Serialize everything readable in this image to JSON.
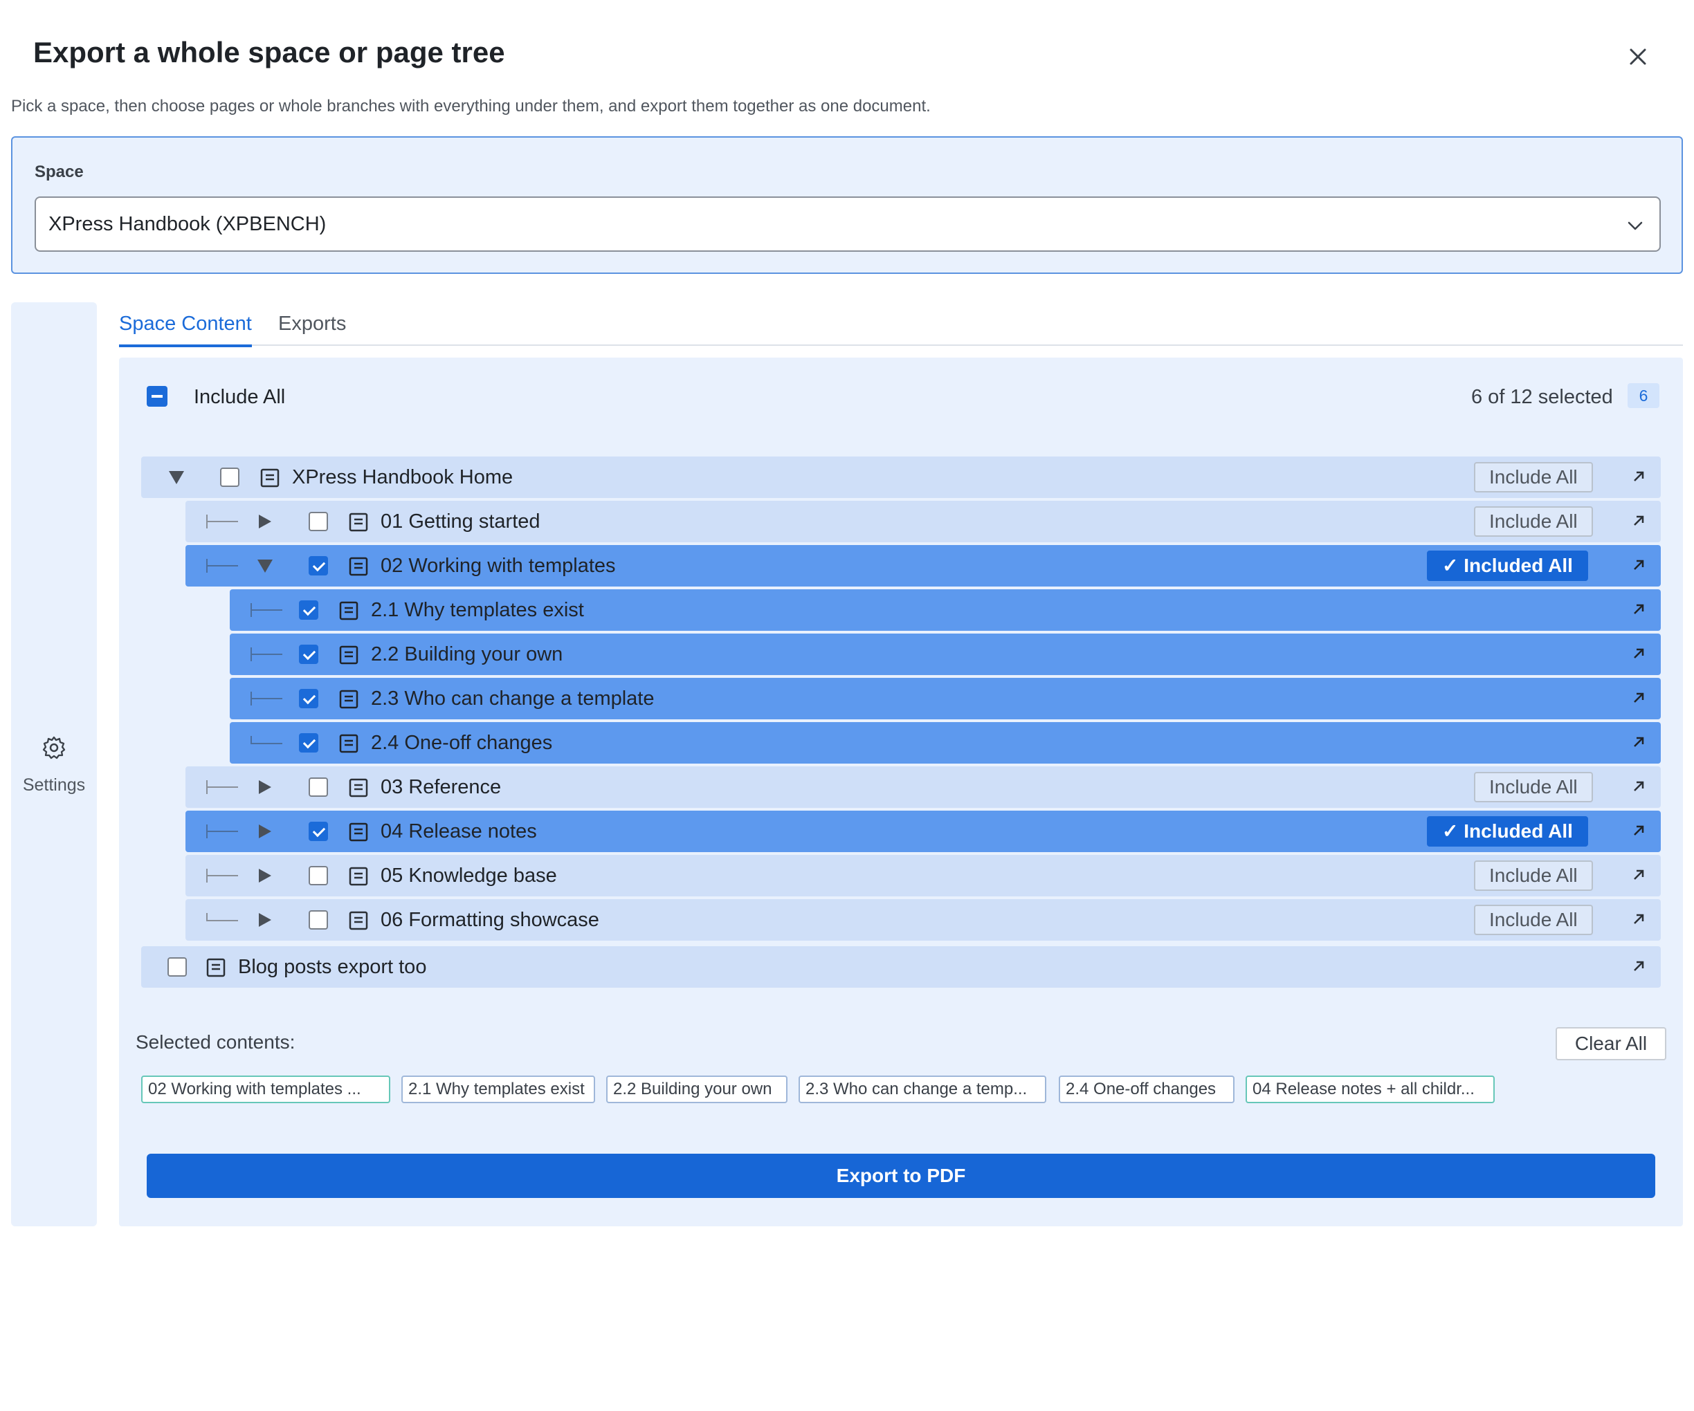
{
  "dialog": {
    "title": "Export a whole space or page tree",
    "subtitle": "Pick a space, then choose pages or whole branches with everything under them, and export them together as one document."
  },
  "space": {
    "label": "Space",
    "selected": "XPress Handbook (XPBENCH)"
  },
  "sidebar": {
    "settings_label": "Settings"
  },
  "tabs": [
    {
      "label": "Space Content",
      "active": true
    },
    {
      "label": "Exports",
      "active": false
    }
  ],
  "content": {
    "include_all_label": "Include All",
    "selected_count_text": "6 of 12 selected",
    "selected_badge": "6",
    "include_all_button": "Include All",
    "included_all_button": "✓ Included All",
    "tree": [
      {
        "label": "XPress Handbook Home",
        "checked": false,
        "expanded": true
      },
      {
        "label": "01 Getting started",
        "checked": false
      },
      {
        "label": "02 Working with templates",
        "checked": true,
        "expanded": true
      },
      {
        "label": "2.1 Why templates exist",
        "checked": true
      },
      {
        "label": "2.2 Building your own",
        "checked": true
      },
      {
        "label": "2.3 Who can change a template",
        "checked": true
      },
      {
        "label": "2.4 One-off changes",
        "checked": true
      },
      {
        "label": "03 Reference",
        "checked": false
      },
      {
        "label": "04 Release notes",
        "checked": true
      },
      {
        "label": "05 Knowledge base",
        "checked": false
      },
      {
        "label": "06 Formatting showcase",
        "checked": false
      },
      {
        "label": "Blog posts export too",
        "checked": false
      }
    ],
    "selected_title": "Selected contents:",
    "clear_all": "Clear All",
    "chips": [
      "02 Working with templates ...",
      "2.1 Why templates exist",
      "2.2 Building your own",
      "2.3 Who can change a temp...",
      "2.4 One-off changes",
      "04 Release notes + all childr..."
    ],
    "export_button": "Export to PDF"
  },
  "colors": {
    "accent": "#1b6bd9",
    "panel_bg": "#e9f1fd",
    "row_bg": "#cfdff8",
    "row_selected_bg": "#5d99ee",
    "chip_border": "#66c7b8"
  },
  "icons": [
    "close-icon",
    "chevron-down-icon",
    "gear-icon",
    "page-icon",
    "open-external-icon",
    "expand-triangle-icon",
    "collapse-triangle-icon"
  ]
}
